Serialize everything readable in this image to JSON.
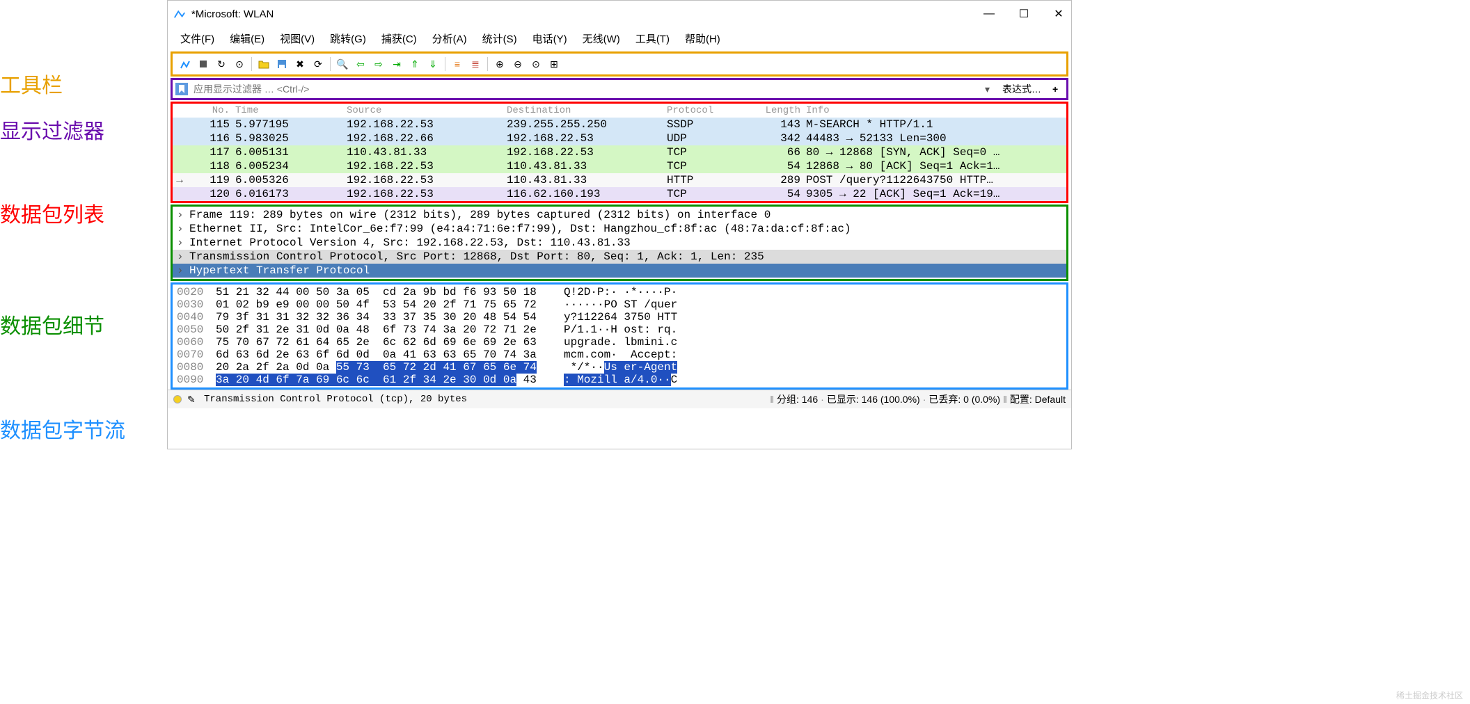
{
  "titlebar": {
    "title": "*Microsoft: WLAN"
  },
  "labels": {
    "toolbar": "工具栏",
    "filter": "显示过滤器",
    "packetlist": "数据包列表",
    "details": "数据包细节",
    "bytes": "数据包字节流"
  },
  "menu": {
    "file": "文件(F)",
    "edit": "编辑(E)",
    "view": "视图(V)",
    "go": "跳转(G)",
    "capture": "捕获(C)",
    "analyze": "分析(A)",
    "stats": "统计(S)",
    "telephony": "电话(Y)",
    "wireless": "无线(W)",
    "tools": "工具(T)",
    "help": "帮助(H)"
  },
  "filter": {
    "placeholder": "应用显示过滤器 … <Ctrl-/>",
    "expression": "表达式…",
    "plus": "+"
  },
  "packet_header": {
    "no": "No.",
    "time": "Time",
    "source": "Source",
    "destination": "Destination",
    "protocol": "Protocol",
    "length": "Length",
    "info": "Info"
  },
  "packets": [
    {
      "cls": "blue1",
      "no": "115",
      "time": "5.977195",
      "src": "192.168.22.53",
      "dst": "239.255.255.250",
      "proto": "SSDP",
      "len": "143",
      "info": "M-SEARCH * HTTP/1.1"
    },
    {
      "cls": "blue2",
      "no": "116",
      "time": "5.983025",
      "src": "192.168.22.66",
      "dst": "192.168.22.53",
      "proto": "UDP",
      "len": "342",
      "info": "44483 → 52133 Len=300"
    },
    {
      "cls": "green",
      "no": "117",
      "time": "6.005131",
      "src": "110.43.81.33",
      "dst": "192.168.22.53",
      "proto": "TCP",
      "len": "66",
      "info": "80 → 12868 [SYN, ACK] Seq=0 …"
    },
    {
      "cls": "green",
      "no": "118",
      "time": "6.005234",
      "src": "192.168.22.53",
      "dst": "110.43.81.33",
      "proto": "TCP",
      "len": "54",
      "info": "12868 → 80 [ACK] Seq=1 Ack=1…"
    },
    {
      "cls": "white",
      "arrow": "→",
      "no": "119",
      "time": "6.005326",
      "src": "192.168.22.53",
      "dst": "110.43.81.33",
      "proto": "HTTP",
      "len": "289",
      "info": "POST /query?1122643750 HTTP…"
    },
    {
      "cls": "lavender",
      "no": "120",
      "time": "6.016173",
      "src": "192.168.22.53",
      "dst": "116.62.160.193",
      "proto": "TCP",
      "len": "54",
      "info": "9305 → 22 [ACK] Seq=1 Ack=19…"
    }
  ],
  "details": {
    "l0": "Frame 119: 289 bytes on wire (2312 bits), 289 bytes captured (2312 bits) on interface 0",
    "l1": "Ethernet II, Src: IntelCor_6e:f7:99 (e4:a4:71:6e:f7:99), Dst: Hangzhou_cf:8f:ac (48:7a:da:cf:8f:ac)",
    "l2": "Internet Protocol Version 4, Src: 192.168.22.53, Dst: 110.43.81.33",
    "l3": "Transmission Control Protocol, Src Port: 12868, Dst Port: 80, Seq: 1, Ack: 1, Len: 235",
    "l4": "Hypertext Transfer Protocol"
  },
  "bytes": [
    {
      "off": "0020",
      "hex": "51 21 32 44 00 50 3a 05  cd 2a 9b bd f6 93 50 18",
      "ascii": "Q!2D·P:· ·*····P·"
    },
    {
      "off": "0030",
      "hex": "01 02 b9 e9 00 00 50 4f  53 54 20 2f 71 75 65 72",
      "ascii": "······PO ST /quer"
    },
    {
      "off": "0040",
      "hex": "79 3f 31 31 32 32 36 34  33 37 35 30 20 48 54 54",
      "ascii": "y?112264 3750 HTT"
    },
    {
      "off": "0050",
      "hex": "50 2f 31 2e 31 0d 0a 48  6f 73 74 3a 20 72 71 2e",
      "ascii": "P/1.1··H ost: rq."
    },
    {
      "off": "0060",
      "hex": "75 70 67 72 61 64 65 2e  6c 62 6d 69 6e 69 2e 63",
      "ascii": "upgrade. lbmini.c"
    },
    {
      "off": "0070",
      "hex": "6d 63 6d 2e 63 6f 6d 0d  0a 41 63 63 65 70 74 3a",
      "ascii": "mcm.com·  Accept:"
    },
    {
      "off": "0080",
      "hex1": "20 2a 2f 2a 0d 0a ",
      "hex_hl": "55 73  65 72 2d 41 67 65 6e 74",
      "ascii1": " */*··",
      "ascii_hl1": "Us er-Agent"
    },
    {
      "off": "0090",
      "hex_hl2": "3a 20 4d 6f 7a 69 6c 6c  61 2f 34 2e 30 0d 0a",
      "hex2": " 43",
      "ascii_hl2": ": Mozill a/4.0··",
      "ascii2": "C"
    }
  ],
  "status": {
    "left": "Transmission Control Protocol (tcp), 20 bytes",
    "groups": "分组: 146",
    "shown": "已显示: 146 (100.0%)",
    "dropped": "已丢弃: 0 (0.0%)",
    "profile": "配置: Default"
  },
  "watermark": "稀土掘金技术社区"
}
